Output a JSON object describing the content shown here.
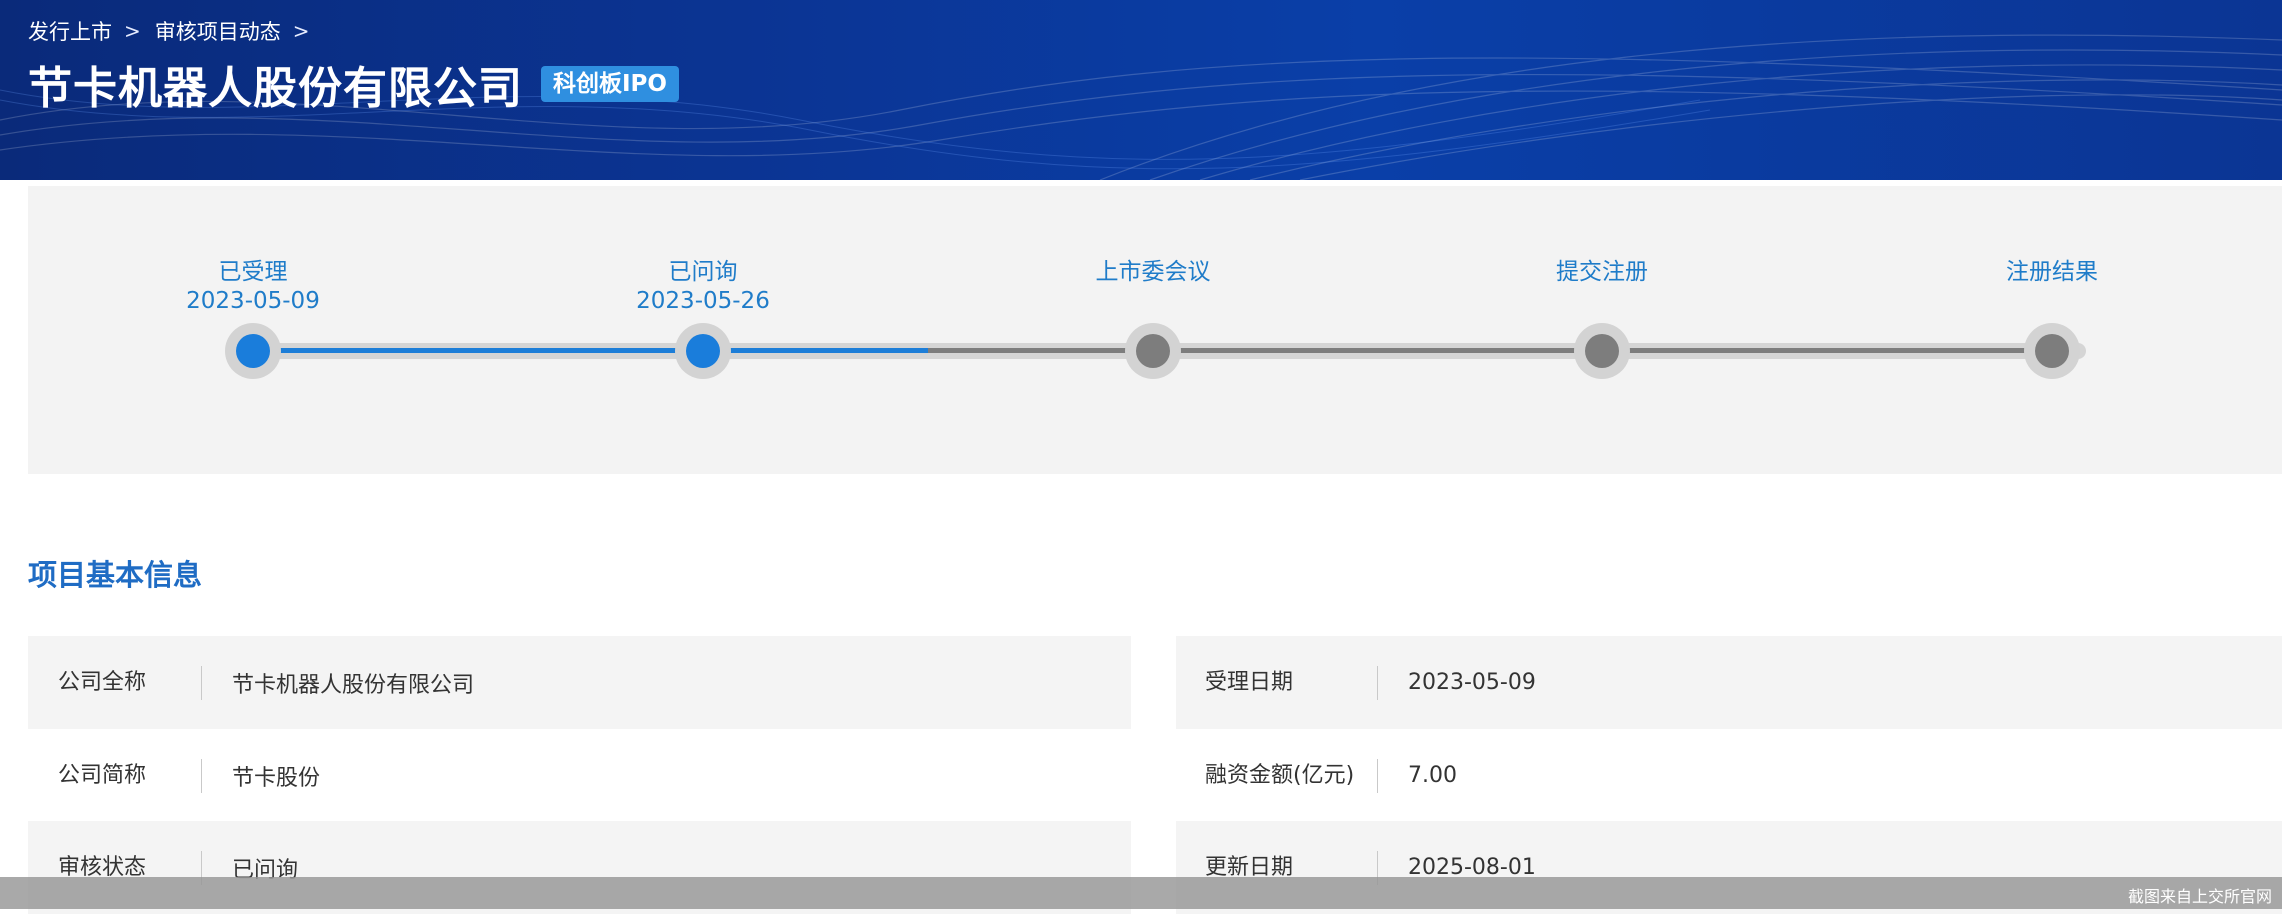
{
  "breadcrumb": {
    "items": [
      "发行上市",
      "审核项目动态"
    ],
    "separator": ">"
  },
  "header": {
    "company_title": "节卡机器人股份有限公司",
    "board_tag": "科创板IPO"
  },
  "progress": {
    "steps": [
      {
        "name": "已受理",
        "date": "2023-05-09",
        "status": "done"
      },
      {
        "name": "已问询",
        "date": "2023-05-26",
        "status": "done"
      },
      {
        "name": "上市委会议",
        "date": "",
        "status": "pending"
      },
      {
        "name": "提交注册",
        "date": "",
        "status": "pending"
      },
      {
        "name": "注册结果",
        "date": "",
        "status": "pending"
      }
    ],
    "completed_fraction": 0.375
  },
  "basic_info": {
    "title": "项目基本信息",
    "left": [
      {
        "label": "公司全称",
        "value": "节卡机器人股份有限公司"
      },
      {
        "label": "公司简称",
        "value": "节卡股份"
      },
      {
        "label": "审核状态",
        "value": "已问询"
      }
    ],
    "right": [
      {
        "label": "受理日期",
        "value": "2023-05-09"
      },
      {
        "label": "融资金额(亿元)",
        "value": "7.00"
      },
      {
        "label": "更新日期",
        "value": "2025-08-01"
      }
    ]
  },
  "footer": {
    "note": "截图来自上交所官网"
  },
  "colors": {
    "header_bg": "#0b3595",
    "tag_bg": "#2f8fe0",
    "progress_done": "#1a7ddb",
    "progress_pending": "#7d7d7d",
    "step_text": "#1f7cc9",
    "section_title": "#1f6cc4",
    "row_shade": "#f4f4f4"
  },
  "icons": {
    "breadcrumb_separator": "chevron-right-icon"
  }
}
